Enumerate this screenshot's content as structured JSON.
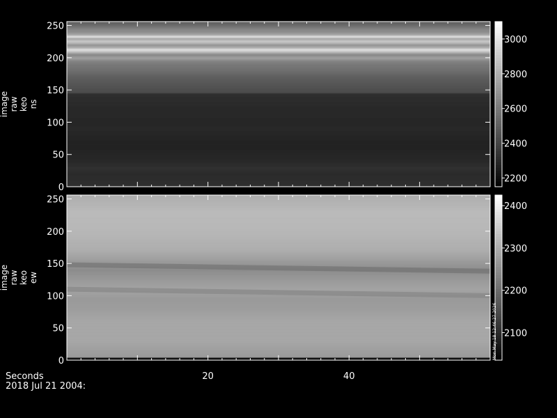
{
  "chart_data": [
    {
      "type": "heatmap",
      "panel": "top",
      "ylabel": [
        "image",
        "raw",
        "keo",
        "ns"
      ],
      "xlim": [
        0,
        60
      ],
      "ylim": [
        0,
        256
      ],
      "yticks": [
        0,
        50,
        100,
        150,
        200,
        250
      ],
      "colorbar": {
        "ticks": [
          2200,
          2400,
          2600,
          2800,
          3000
        ],
        "range": [
          2150,
          3100
        ]
      },
      "row_profile": [
        {
          "y": 0,
          "v": 2330
        },
        {
          "y": 10,
          "v": 2320
        },
        {
          "y": 20,
          "v": 2310
        },
        {
          "y": 30,
          "v": 2330
        },
        {
          "y": 40,
          "v": 2300
        },
        {
          "y": 50,
          "v": 2290
        },
        {
          "y": 60,
          "v": 2280
        },
        {
          "y": 70,
          "v": 2280
        },
        {
          "y": 80,
          "v": 2290
        },
        {
          "y": 90,
          "v": 2300
        },
        {
          "y": 100,
          "v": 2290
        },
        {
          "y": 110,
          "v": 2300
        },
        {
          "y": 120,
          "v": 2300
        },
        {
          "y": 130,
          "v": 2310
        },
        {
          "y": 140,
          "v": 2320
        },
        {
          "y": 145,
          "v": 2330
        },
        {
          "y": 146,
          "v": 2430
        },
        {
          "y": 160,
          "v": 2470
        },
        {
          "y": 170,
          "v": 2500
        },
        {
          "y": 180,
          "v": 2560
        },
        {
          "y": 190,
          "v": 2600
        },
        {
          "y": 195,
          "v": 2640
        },
        {
          "y": 200,
          "v": 2750
        },
        {
          "y": 205,
          "v": 2650
        },
        {
          "y": 210,
          "v": 2880
        },
        {
          "y": 213,
          "v": 2990
        },
        {
          "y": 216,
          "v": 2800
        },
        {
          "y": 220,
          "v": 2700
        },
        {
          "y": 223,
          "v": 2820
        },
        {
          "y": 226,
          "v": 2900
        },
        {
          "y": 230,
          "v": 2760
        },
        {
          "y": 233,
          "v": 3000
        },
        {
          "y": 236,
          "v": 2780
        },
        {
          "y": 240,
          "v": 2680
        },
        {
          "y": 245,
          "v": 2640
        },
        {
          "y": 250,
          "v": 2560
        },
        {
          "y": 256,
          "v": 2500
        }
      ]
    },
    {
      "type": "heatmap",
      "panel": "bottom",
      "ylabel": [
        "image",
        "raw",
        "keo",
        "ew"
      ],
      "xlim": [
        0,
        60
      ],
      "ylim": [
        0,
        256
      ],
      "yticks": [
        0,
        50,
        100,
        150,
        200,
        250
      ],
      "xticks": [
        20,
        40
      ],
      "xlabel": "Seconds",
      "colorbar": {
        "ticks": [
          2100,
          2200,
          2300,
          2400
        ],
        "range": [
          2035,
          2425
        ]
      },
      "row_profile": [
        {
          "y": 0,
          "v": 2060
        },
        {
          "y": 4,
          "v": 2060
        },
        {
          "y": 5,
          "v": 2270
        },
        {
          "y": 30,
          "v": 2290
        },
        {
          "y": 60,
          "v": 2290
        },
        {
          "y": 80,
          "v": 2275
        },
        {
          "y": 95,
          "v": 2270
        },
        {
          "y": 110,
          "v": 2285
        },
        {
          "y": 125,
          "v": 2270
        },
        {
          "y": 140,
          "v": 2250
        },
        {
          "y": 155,
          "v": 2275
        },
        {
          "y": 170,
          "v": 2300
        },
        {
          "y": 200,
          "v": 2315
        },
        {
          "y": 230,
          "v": 2320
        },
        {
          "y": 256,
          "v": 2300
        }
      ],
      "dark_bands": [
        {
          "x": [
            0,
            60
          ],
          "y": [
            148,
            138
          ],
          "v": 2200
        },
        {
          "x": [
            0,
            60
          ],
          "y": [
            110,
            100
          ],
          "v": 2230
        }
      ]
    }
  ],
  "footer": {
    "xlabel": "Seconds",
    "date": "2018 Jul 21 2004:"
  },
  "stamp": "Mon May 18 12:46:27 2026"
}
